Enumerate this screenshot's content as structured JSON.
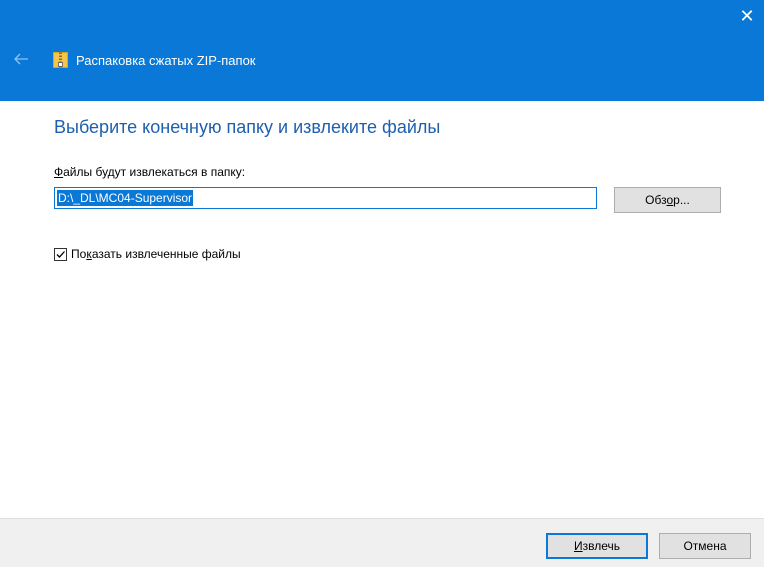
{
  "window": {
    "title": "Распаковка сжатых ZIP-папок",
    "close_glyph": "✕",
    "accent_color": "#0a78d7"
  },
  "main": {
    "heading": "Выберите конечную папку и извлеките файлы",
    "destination_label": {
      "mnemonic": "Ф",
      "rest": "айлы будут извлекаться в папку:"
    },
    "path_value": "D:\\_DL\\MC04-Supervisor",
    "browse_button": {
      "pre": "Обз",
      "mnemonic": "о",
      "post": "р..."
    },
    "show_files_checkbox": {
      "checked": true,
      "pre": "По",
      "mnemonic": "к",
      "post": "азать извлеченные файлы"
    }
  },
  "footer": {
    "extract_button": {
      "mnemonic": "И",
      "rest": "звлечь"
    },
    "cancel_button": "Отмена"
  },
  "icons": {
    "back": "back-arrow-icon",
    "zip": "zip-folder-icon",
    "close": "close-icon",
    "check": "checkmark-icon"
  }
}
